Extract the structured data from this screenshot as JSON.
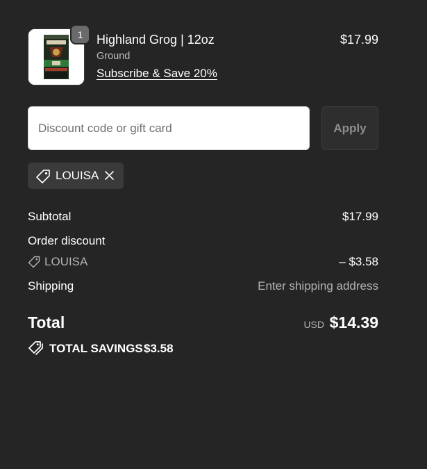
{
  "product": {
    "quantity": "1",
    "name": "Highland Grog | 12oz",
    "variant": "Ground",
    "subscribe_link": "Subscribe & Save 20%",
    "price": "$17.99"
  },
  "discount": {
    "placeholder": "Discount code or gift card",
    "value": "",
    "apply_label": "Apply",
    "applied_code": "LOUISA",
    "tag_icon": "tag-icon",
    "remove_icon": "close-icon"
  },
  "summary": {
    "subtotal_label": "Subtotal",
    "subtotal_value": "$17.99",
    "order_discount_label": "Order discount",
    "discount_code": "LOUISA",
    "discount_value": "– $3.58",
    "shipping_label": "Shipping",
    "shipping_value": "Enter shipping address",
    "total_label": "Total",
    "currency": "USD",
    "total_value": "$14.39",
    "savings_label": "TOTAL SAVINGS",
    "savings_value": "$3.58"
  },
  "colors": {
    "background": "#252525",
    "chip": "#3a3a3a",
    "muted_text": "#b3b3b3",
    "badge": "#6a6a6a"
  }
}
